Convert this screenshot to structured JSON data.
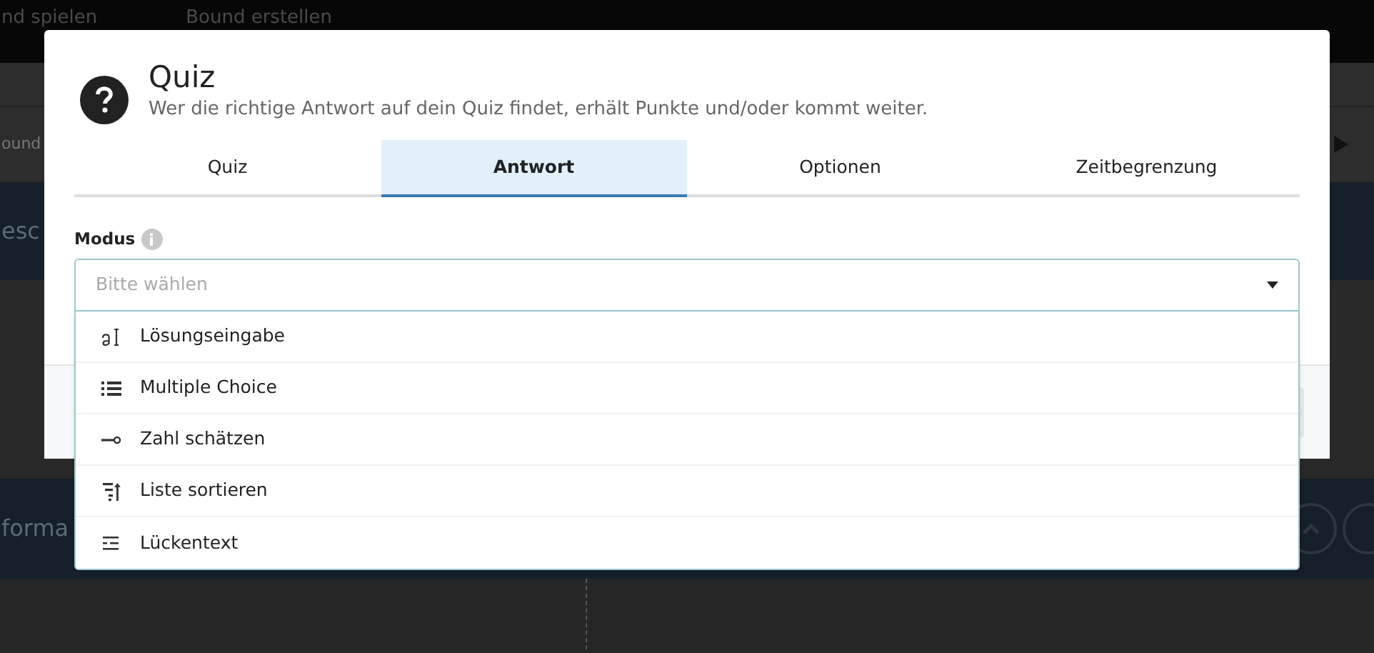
{
  "background": {
    "nav": [
      "nd spielen",
      "Bound erstellen"
    ],
    "breadcrumb": "ound",
    "section_1": "esc",
    "section_2": "forma"
  },
  "dialog": {
    "title": "Quiz",
    "subtitle": "Wer die richtige Antwort auf dein Quiz findet, erhält Punkte und/oder kommt weiter.",
    "tabs": [
      {
        "label": "Quiz",
        "selected": false
      },
      {
        "label": "Antwort",
        "selected": true
      },
      {
        "label": "Optionen",
        "selected": false
      },
      {
        "label": "Zeitbegrenzung",
        "selected": false
      }
    ],
    "field": {
      "label": "Modus",
      "placeholder": "Bitte wählen",
      "expanded": true,
      "options": [
        {
          "label": "Lösungseingabe",
          "kind": "input"
        },
        {
          "label": "Multiple Choice",
          "kind": "list"
        },
        {
          "label": "Zahl schätzen",
          "kind": "estimate"
        },
        {
          "label": "Liste sortieren",
          "kind": "sort"
        },
        {
          "label": "Lückentext",
          "kind": "gap"
        }
      ]
    }
  }
}
